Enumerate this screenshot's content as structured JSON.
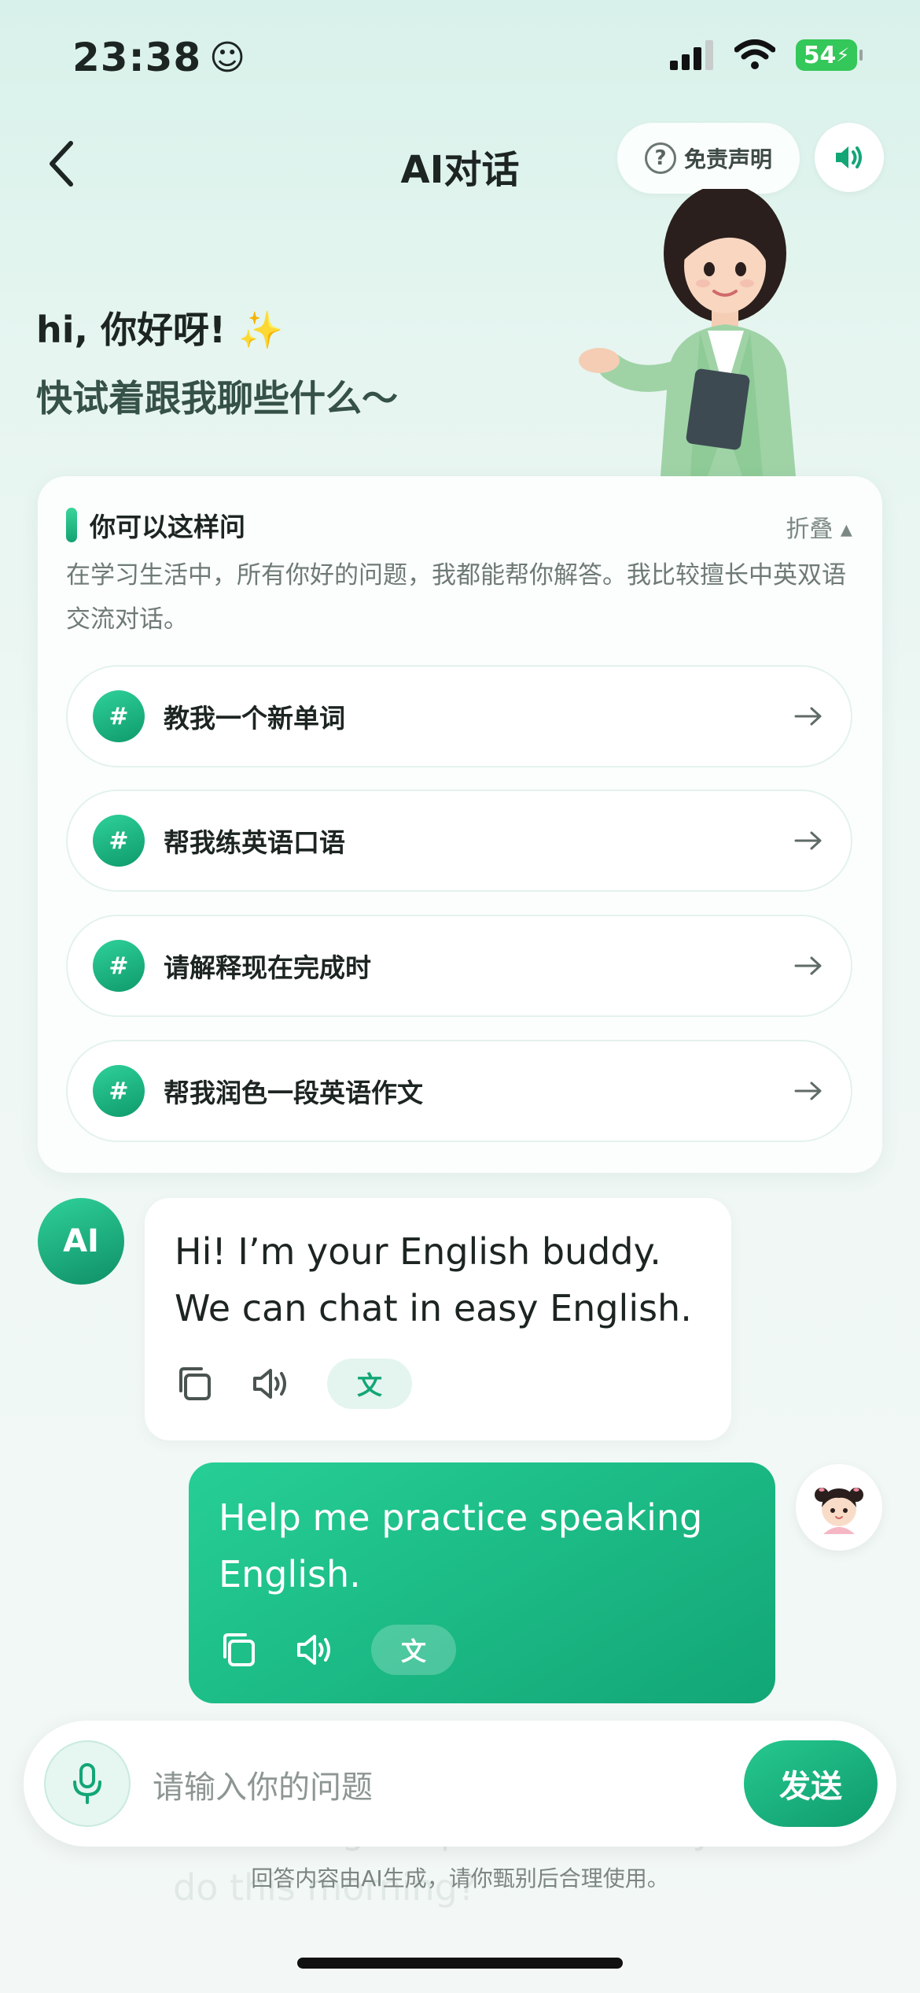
{
  "status_bar": {
    "time": "23:38",
    "time_emoji": "☺",
    "battery": "54"
  },
  "nav": {
    "title": "AI对话",
    "disclaimer": "免责声明"
  },
  "greeting": {
    "line1": "hi, 你好呀!",
    "sparkle": "✨",
    "line2": "快试着跟我聊些什么～"
  },
  "suggestions": {
    "title": "你可以这样问",
    "fold_label": "折叠 ▴",
    "description": "在学习生活中，所有你好的问题，我都能帮你解答。我比较擅长中英双语交流对话。",
    "hash": "#",
    "items": [
      {
        "label": "教我一个新单词"
      },
      {
        "label": "帮我练英语口语"
      },
      {
        "label": "请解释现在完成时"
      },
      {
        "label": "帮我润色一段英语作文"
      }
    ]
  },
  "chat": {
    "ai_avatar_label": "AI",
    "messages": [
      {
        "role": "ai",
        "text": "Hi! I’m your English buddy. We can chat in easy English.",
        "translate_label": "文"
      },
      {
        "role": "user",
        "text": "Help me practice speaking English.",
        "translate_label": "文"
      }
    ]
  },
  "ghost_text": "something simple. What did you do this morning?",
  "input": {
    "placeholder": "请输入你的问题",
    "send_label": "发送"
  },
  "footer_note": "回答内容由AI生成，请你甄别后合理使用。",
  "colors": {
    "accent": "#12a676",
    "accent_light": "#26cf95",
    "battery_green": "#34c759"
  }
}
